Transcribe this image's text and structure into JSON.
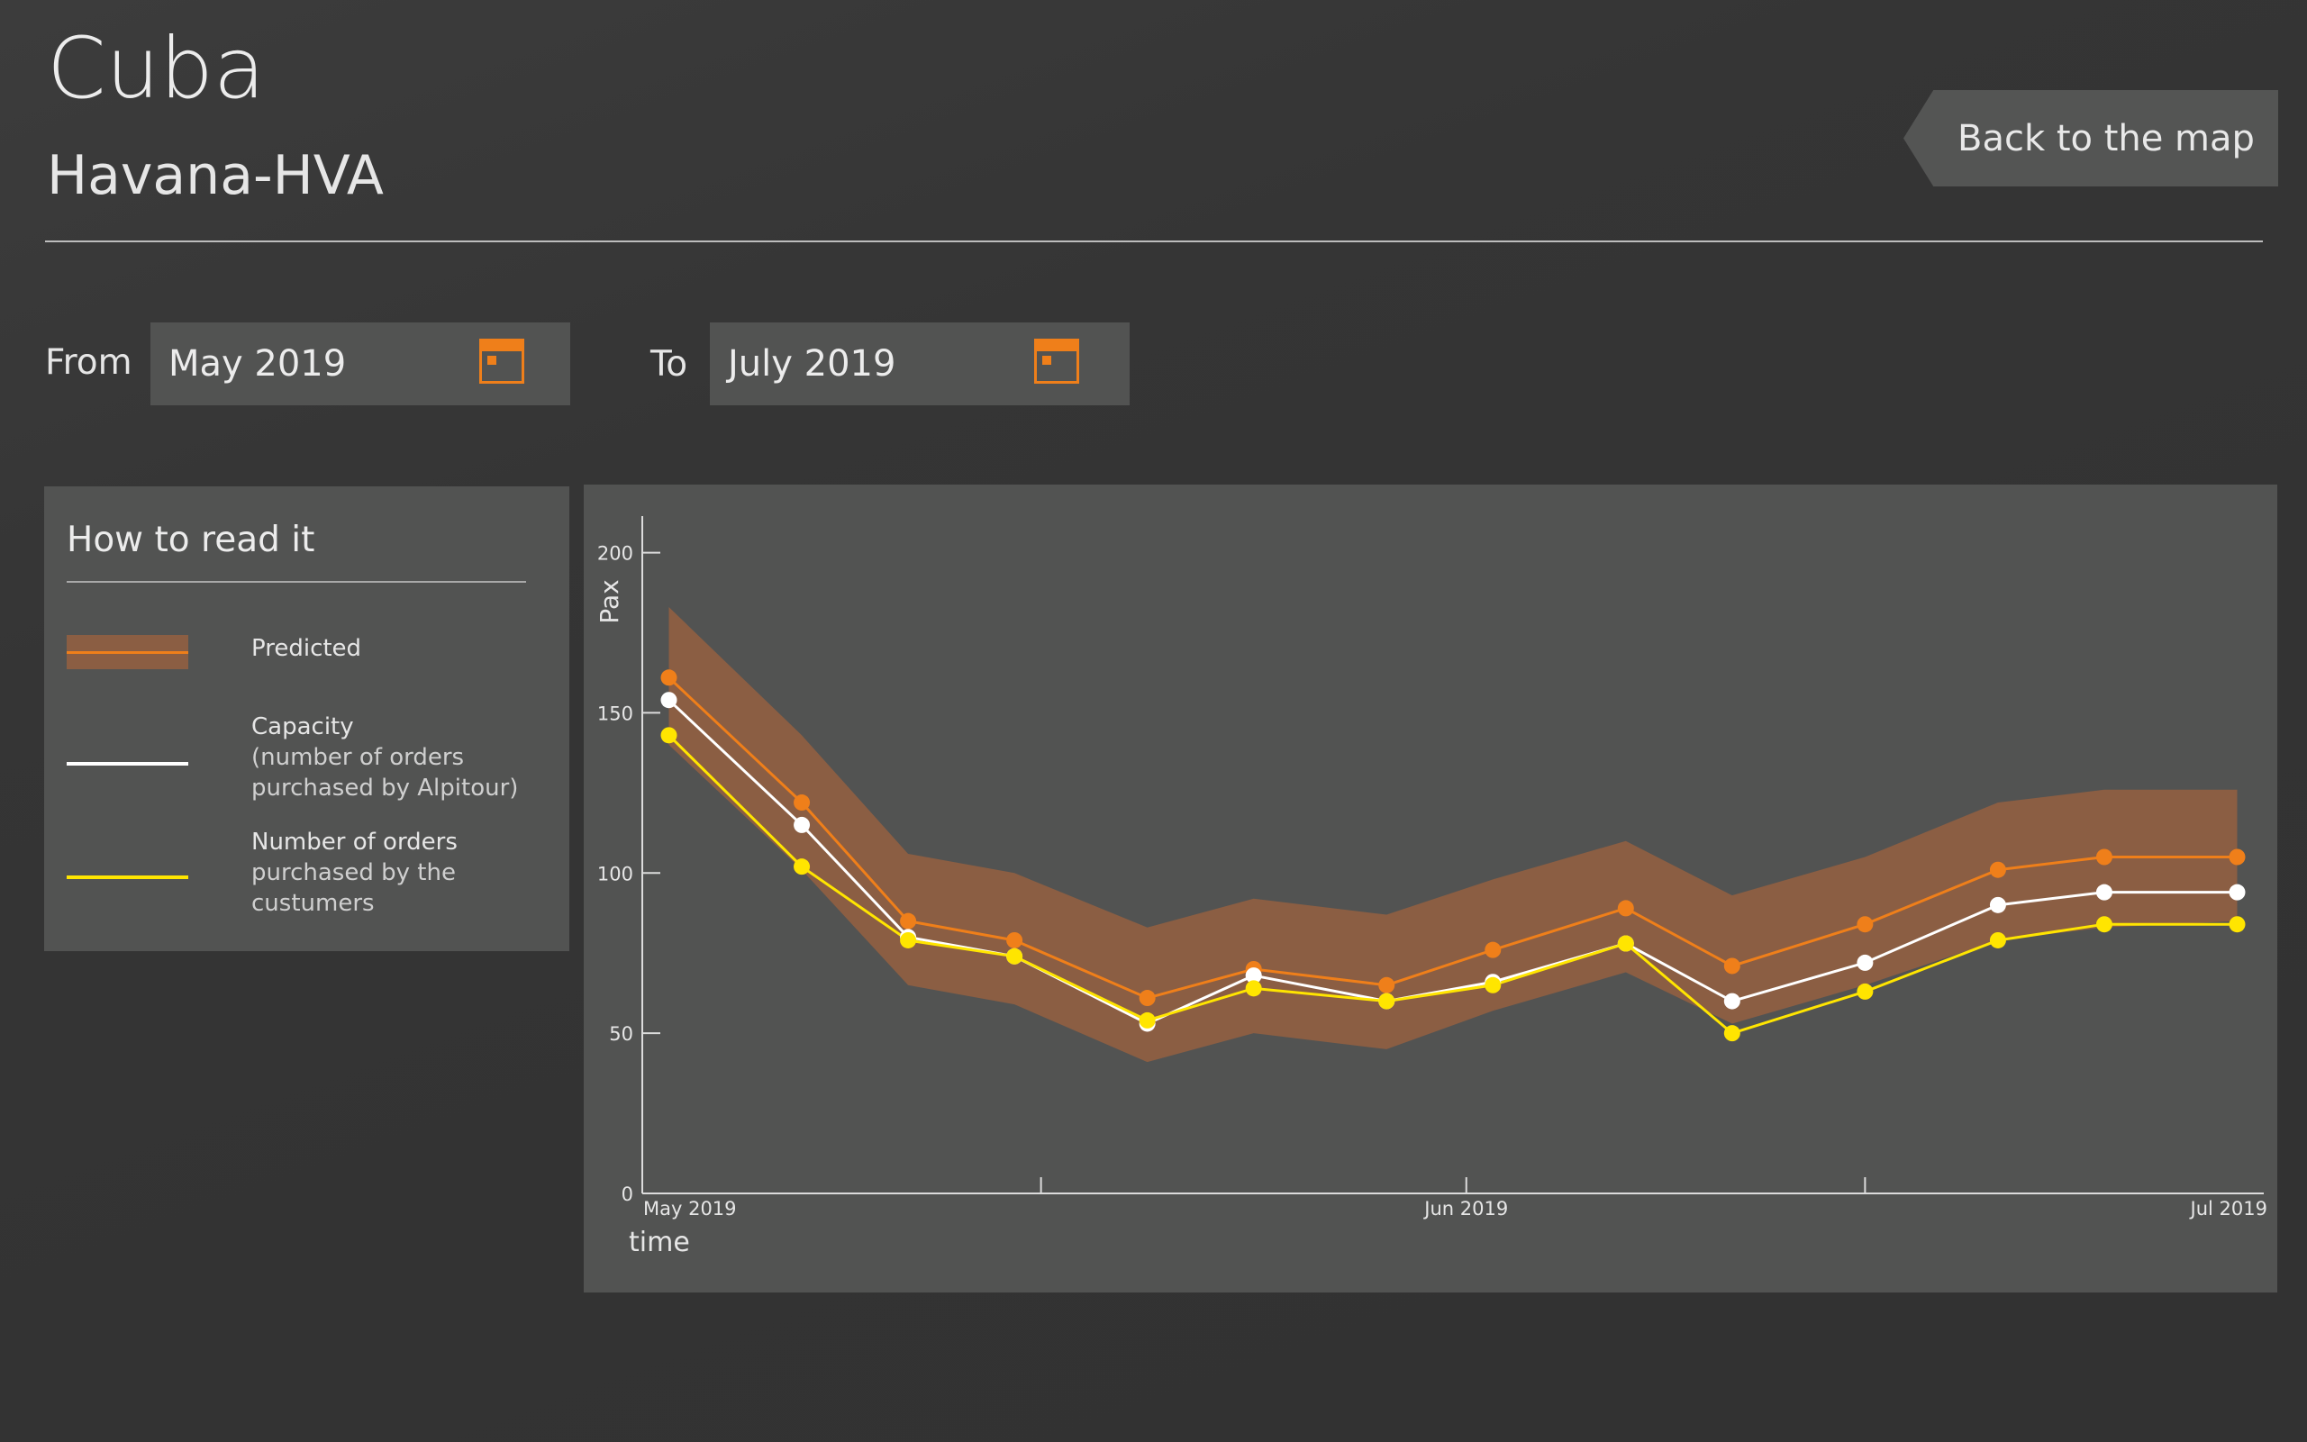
{
  "header": {
    "title": "Cuba",
    "subtitle": "Havana-HVA",
    "back_button": "Back to the map"
  },
  "filters": {
    "from_label": "From",
    "from_value": "May 2019",
    "to_label": "To",
    "to_value": "July 2019",
    "calendar_icon": "calendar-icon"
  },
  "legend": {
    "title": "How to read it",
    "items": [
      {
        "label": "Predicted",
        "sub": ""
      },
      {
        "label": "Capacity",
        "sub": "(number of orders purchased by Alpitour)"
      },
      {
        "label": "Number of orders",
        "sub": "purchased by the custumers"
      }
    ]
  },
  "colors": {
    "predicted": "#ef7f1a",
    "predicted_band": "#8b5e43",
    "capacity": "#ffffff",
    "orders": "#ffe500"
  },
  "chart_data": {
    "type": "line",
    "ylabel": "Pax",
    "xlabel": "time",
    "ylim": [
      0,
      210
    ],
    "yticks": [
      0,
      50,
      100,
      150,
      200
    ],
    "xlim": [
      "2019-05-01",
      "2019-07-01"
    ],
    "xtick_labels": [
      {
        "x": "2019-05-01",
        "label": "May 2019"
      },
      {
        "x": "2019-06-01",
        "label": "Jun 2019"
      },
      {
        "x": "2019-07-01",
        "label": "Jul 2019"
      }
    ],
    "xticks_minor": [
      "2019-05-16",
      "2019-06-16"
    ],
    "x": [
      "2019-05-02",
      "2019-05-07",
      "2019-05-11",
      "2019-05-15",
      "2019-05-20",
      "2019-05-24",
      "2019-05-29",
      "2019-06-02",
      "2019-06-07",
      "2019-06-11",
      "2019-06-16",
      "2019-06-21",
      "2019-06-25",
      "2019-06-30"
    ],
    "predicted_range": {
      "upper": [
        183,
        143,
        106,
        100,
        83,
        92,
        87,
        98,
        110,
        93,
        105,
        122,
        126,
        126
      ],
      "lower": [
        140,
        101,
        65,
        59,
        41,
        50,
        45,
        57,
        69,
        53,
        65,
        79,
        83,
        85
      ]
    },
    "series": [
      {
        "name": "Predicted",
        "values": [
          161,
          122,
          85,
          79,
          61,
          70,
          65,
          76,
          89,
          71,
          84,
          101,
          105,
          105
        ]
      },
      {
        "name": "Capacity",
        "values": [
          154,
          115,
          80,
          74,
          53,
          68,
          60,
          66,
          78,
          60,
          72,
          90,
          94,
          94
        ]
      },
      {
        "name": "Number of orders",
        "values": [
          143,
          102,
          79,
          74,
          54,
          64,
          60,
          65,
          78,
          50,
          63,
          79,
          84,
          84
        ]
      }
    ]
  }
}
